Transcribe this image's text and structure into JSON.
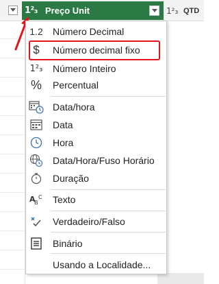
{
  "header": {
    "selected_column": {
      "type_tag": "1²₃",
      "title": "Preço Unit"
    },
    "next_column": {
      "type_tag": "1²₃",
      "title": "QTD"
    }
  },
  "menu": {
    "items": [
      {
        "label": "Número Decimal",
        "icon": "decimal-number-icon",
        "glyph": "1.2"
      },
      {
        "label": "Número decimal fixo",
        "icon": "currency-dollar-icon",
        "glyph": "$",
        "highlighted": true
      },
      {
        "label": "Número Inteiro",
        "icon": "whole-number-icon",
        "glyph": "1²₃"
      },
      {
        "label": "Percentual",
        "icon": "percent-icon",
        "glyph": "%"
      },
      {
        "label": "Data/hora",
        "icon": "datetime-icon"
      },
      {
        "label": "Data",
        "icon": "calendar-icon"
      },
      {
        "label": "Hora",
        "icon": "clock-icon"
      },
      {
        "label": "Data/Hora/Fuso Horário",
        "icon": "globe-clock-icon"
      },
      {
        "label": "Duração",
        "icon": "stopwatch-icon"
      },
      {
        "label": "Texto",
        "icon": "text-abc-icon",
        "glyph": "ABC"
      },
      {
        "label": "Verdadeiro/Falso",
        "icon": "true-false-icon"
      },
      {
        "label": "Binário",
        "icon": "binary-icon"
      },
      {
        "label": "Usando a Localidade..."
      }
    ]
  },
  "colors": {
    "selected_header_bg": "#2b7a45",
    "highlight_border": "#e3141c",
    "arrow": "#e3141c"
  }
}
